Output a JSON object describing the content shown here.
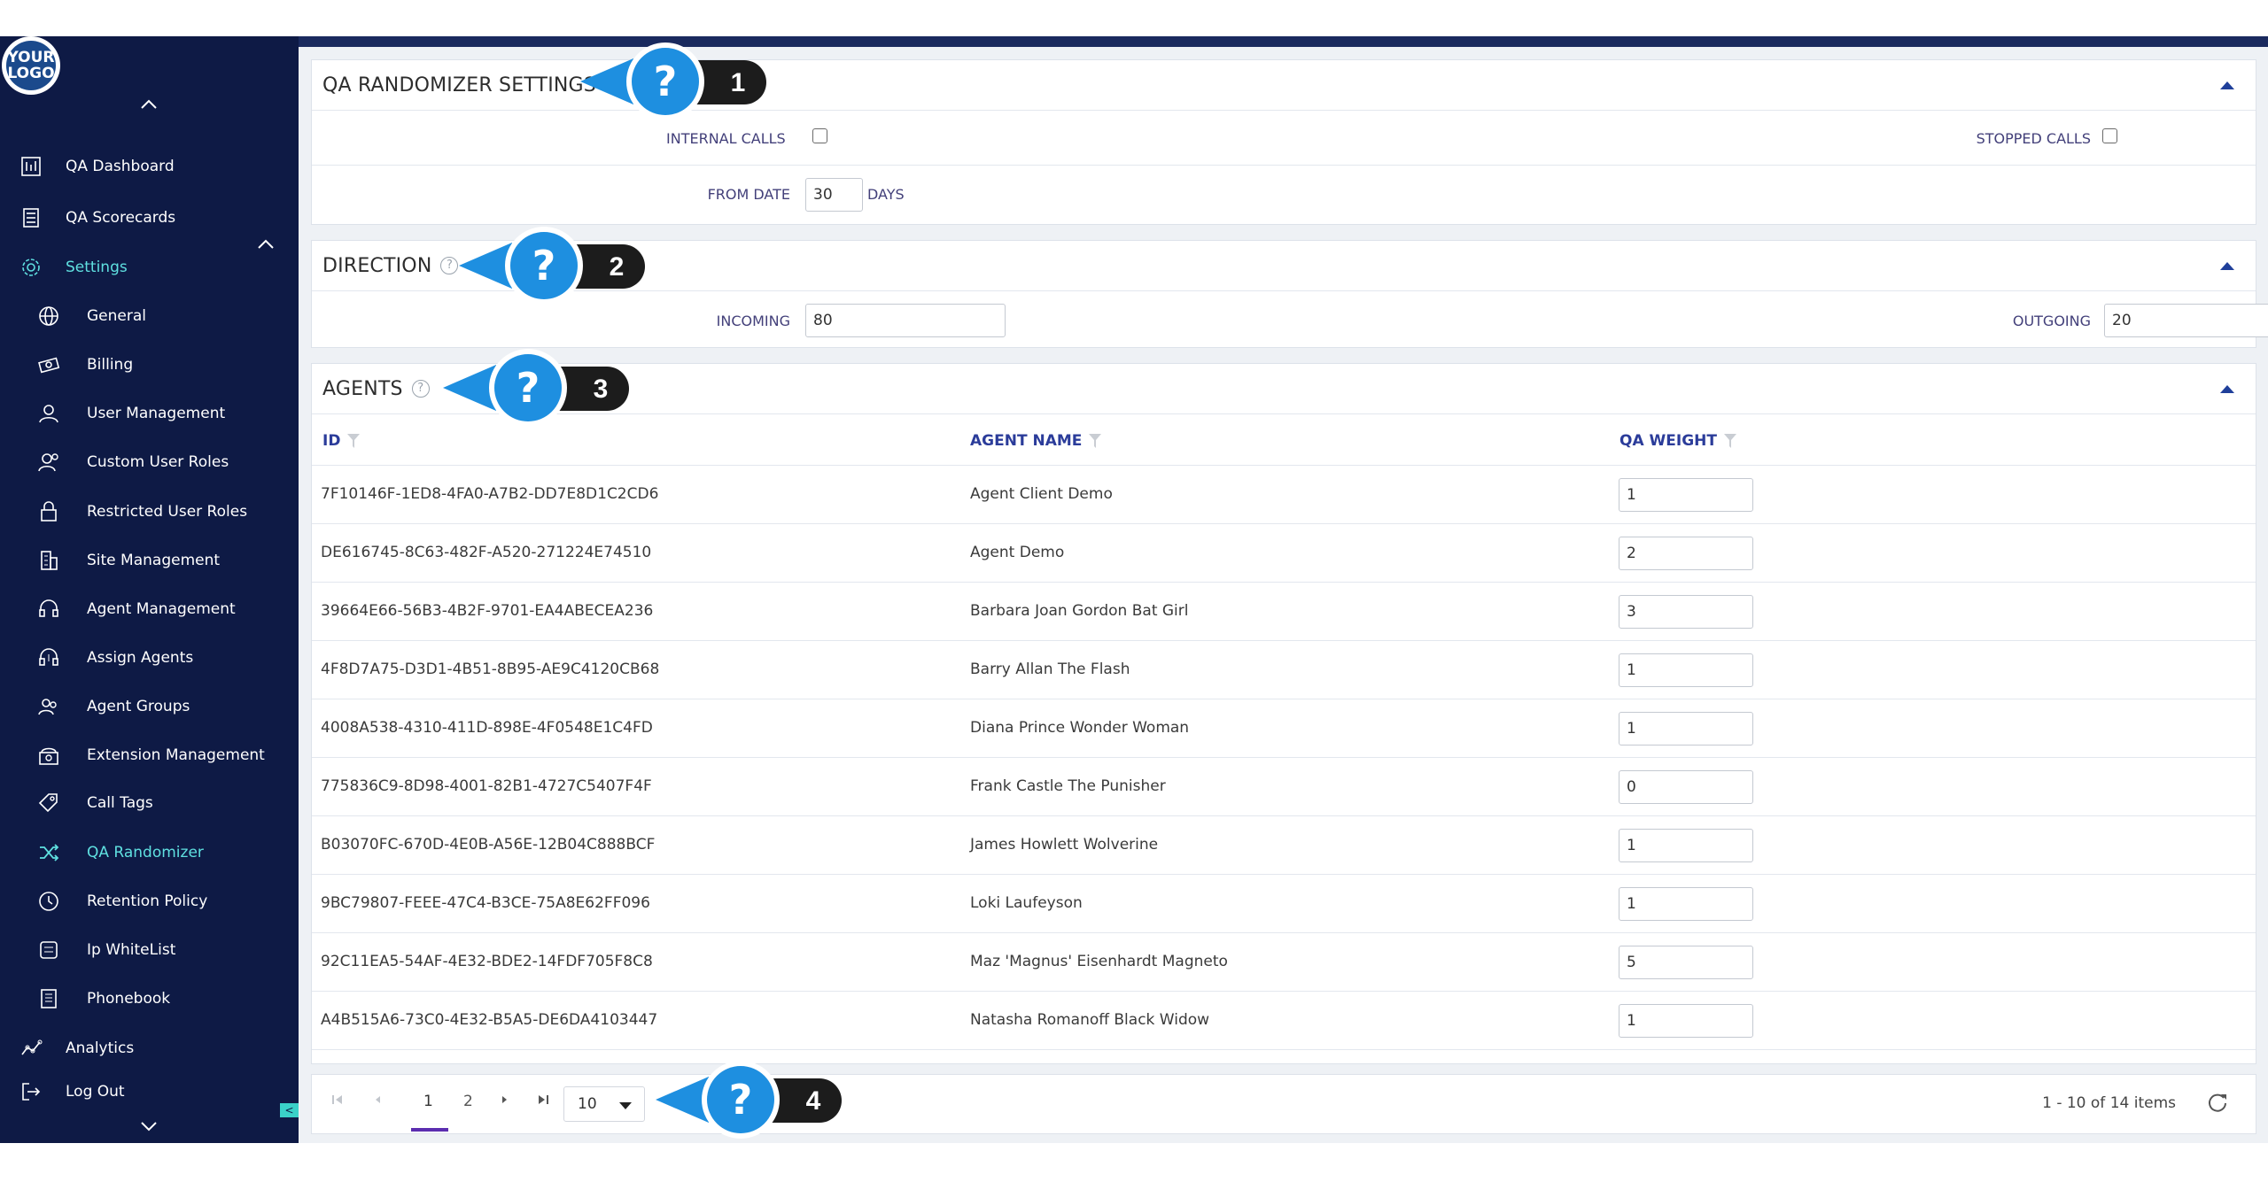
{
  "logo": {
    "line1": "YOUR",
    "line2": "LOGO"
  },
  "sidebar": {
    "items": [
      {
        "label": "QA Dashboard",
        "icon": "dashboard-icon",
        "level": "top"
      },
      {
        "label": "QA Scorecards",
        "icon": "scorecard-icon",
        "level": "top"
      },
      {
        "label": "Settings",
        "icon": "gear-icon",
        "level": "top",
        "active": true
      },
      {
        "label": "General",
        "icon": "globe-icon",
        "level": "sub"
      },
      {
        "label": "Billing",
        "icon": "money-icon",
        "level": "sub"
      },
      {
        "label": "User Management",
        "icon": "user-icon",
        "level": "sub"
      },
      {
        "label": "Custom User Roles",
        "icon": "user-role-icon",
        "level": "sub"
      },
      {
        "label": "Restricted User Roles",
        "icon": "lock-icon",
        "level": "sub"
      },
      {
        "label": "Site Management",
        "icon": "building-icon",
        "level": "sub"
      },
      {
        "label": "Agent Management",
        "icon": "headset-icon",
        "level": "sub"
      },
      {
        "label": "Assign Agents",
        "icon": "headset-assign-icon",
        "level": "sub"
      },
      {
        "label": "Agent Groups",
        "icon": "agent-group-icon",
        "level": "sub"
      },
      {
        "label": "Extension Management",
        "icon": "phone-icon",
        "level": "sub"
      },
      {
        "label": "Call Tags",
        "icon": "tag-icon",
        "level": "sub"
      },
      {
        "label": "QA Randomizer",
        "icon": "shuffle-icon",
        "level": "sub",
        "active": true
      },
      {
        "label": "Retention Policy",
        "icon": "clock-icon",
        "level": "sub"
      },
      {
        "label": "Ip WhiteList",
        "icon": "list-icon",
        "level": "sub"
      },
      {
        "label": "Phonebook",
        "icon": "phonebook-icon",
        "level": "sub"
      },
      {
        "label": "Analytics",
        "icon": "analytics-icon",
        "level": "top"
      },
      {
        "label": "Log Out",
        "icon": "logout-icon",
        "level": "top"
      }
    ],
    "toggle_label": "<"
  },
  "settings_panel": {
    "title": "QA RANDOMIZER SETTINGS",
    "internal_calls_label": "INTERNAL CALLS",
    "stopped_calls_label": "STOPPED CALLS",
    "from_date_label": "FROM DATE",
    "from_date_value": "30",
    "days_label": "DAYS"
  },
  "direction_panel": {
    "title": "DIRECTION",
    "help": "?",
    "incoming_label": "INCOMING",
    "incoming_value": "80",
    "outgoing_label": "OUTGOING",
    "outgoing_value": "20"
  },
  "agents_panel": {
    "title": "AGENTS",
    "help": "?",
    "columns": {
      "id": "ID",
      "name": "AGENT NAME",
      "weight": "QA WEIGHT"
    },
    "rows": [
      {
        "id": "7F10146F-1ED8-4FA0-A7B2-DD7E8D1C2CD6",
        "name": "Agent Client Demo",
        "weight": "1"
      },
      {
        "id": "DE616745-8C63-482F-A520-271224E74510",
        "name": "Agent Demo",
        "weight": "2"
      },
      {
        "id": "39664E66-56B3-4B2F-9701-EA4ABECEA236",
        "name": "Barbara Joan Gordon Bat Girl",
        "weight": "3"
      },
      {
        "id": "4F8D7A75-D3D1-4B51-8B95-AE9C4120CB68",
        "name": "Barry Allan The Flash",
        "weight": "1"
      },
      {
        "id": "4008A538-4310-411D-898E-4F0548E1C4FD",
        "name": "Diana Prince Wonder Woman",
        "weight": "1"
      },
      {
        "id": "775836C9-8D98-4001-82B1-4727C5407F4F",
        "name": "Frank Castle The Punisher",
        "weight": "0"
      },
      {
        "id": "B03070FC-670D-4E0B-A56E-12B04C888BCF",
        "name": "James Howlett Wolverine",
        "weight": "1"
      },
      {
        "id": "9BC79807-FEEE-47C4-B3CE-75A8E62FF096",
        "name": "Loki Laufeyson",
        "weight": "1"
      },
      {
        "id": "92C11EA5-54AF-4E32-BDE2-14FDF705F8C8",
        "name": "Maz 'Magnus' Eisenhardt Magneto",
        "weight": "5"
      },
      {
        "id": "A4B515A6-73C0-4E32-B5A5-DE6DA4103447",
        "name": "Natasha Romanoff Black Widow",
        "weight": "1"
      }
    ]
  },
  "pager": {
    "pages": [
      "1",
      "2"
    ],
    "page_size": "10",
    "info": "1 - 10 of 14 items"
  },
  "callouts": [
    {
      "glyph": "?",
      "number": "1"
    },
    {
      "glyph": "?",
      "number": "2"
    },
    {
      "glyph": "?",
      "number": "3"
    },
    {
      "glyph": "?",
      "number": "4"
    }
  ],
  "colors": {
    "sidebar_bg": "#0e1a45",
    "active_item": "#5fe0e0",
    "header_accent": "#2b3c9a",
    "callout_blue": "#1e8fe0",
    "callout_dark": "#1c1c1c",
    "pager_active": "#5b2db0"
  }
}
